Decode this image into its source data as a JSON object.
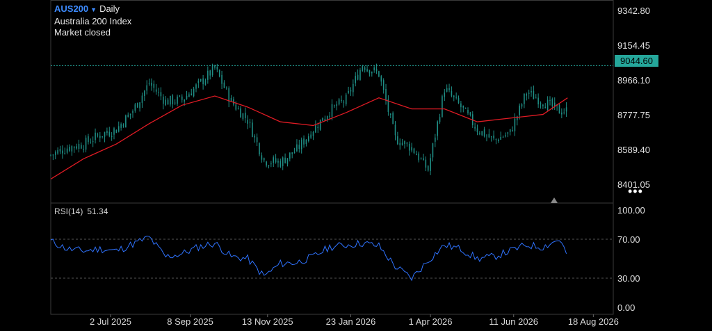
{
  "header": {
    "symbol": "AUS200",
    "interval": "Daily",
    "index_name": "Australia 200 Index",
    "market_status": "Market closed"
  },
  "current_price": "9044.60",
  "colors": {
    "background": "#000000",
    "candle": "#1f8f86",
    "moving_average": "#e01b24",
    "rsi_line": "#2f73ff",
    "price_line": "#25a79b",
    "grid_border": "#3a3a3a"
  },
  "icons": {
    "symbol_caret": "▼",
    "more": "•••"
  },
  "indicator": {
    "name": "RSI(14)",
    "value": "51.34"
  },
  "chart_data": [
    {
      "type": "candlestick",
      "series": [
        {
          "name": "AUS200",
          "kind": "ohlc",
          "x": [
            "2025-05-12",
            "2025-05-26",
            "2025-06-09",
            "2025-06-23",
            "2025-07-07",
            "2025-07-21",
            "2025-08-04",
            "2025-08-18",
            "2025-09-01",
            "2025-09-15",
            "2025-09-29",
            "2025-10-13",
            "2025-10-27",
            "2025-11-10",
            "2025-11-24",
            "2025-12-08",
            "2025-12-22",
            "2026-01-05",
            "2026-01-19",
            "2026-02-02",
            "2026-02-16",
            "2026-03-02",
            "2026-03-16",
            "2026-03-30",
            "2026-04-13",
            "2026-04-27",
            "2026-05-11",
            "2026-05-25",
            "2026-06-08",
            "2026-06-22",
            "2026-07-06",
            "2026-07-20"
          ],
          "close": [
            8560,
            8600,
            8620,
            8670,
            8700,
            8800,
            8950,
            8850,
            8860,
            8940,
            9030,
            8850,
            8750,
            8530,
            8520,
            8590,
            8700,
            8800,
            8860,
            9050,
            9000,
            8650,
            8600,
            8480,
            8920,
            8820,
            8700,
            8640,
            8680,
            8900,
            8850,
            8800
          ]
        },
        {
          "name": "MA",
          "kind": "line",
          "x": [
            "2025-05-12",
            "2025-06-09",
            "2025-07-07",
            "2025-08-04",
            "2025-09-01",
            "2025-09-29",
            "2025-10-27",
            "2025-11-24",
            "2025-12-22",
            "2026-01-19",
            "2026-02-16",
            "2026-03-16",
            "2026-04-13",
            "2026-05-11",
            "2026-06-08",
            "2026-07-06",
            "2026-07-27"
          ],
          "y": [
            8430,
            8540,
            8620,
            8730,
            8830,
            8880,
            8820,
            8740,
            8720,
            8790,
            8870,
            8810,
            8810,
            8740,
            8760,
            8780,
            8870
          ]
        }
      ],
      "y_ticks": [
        "9342.80",
        "9154.45",
        "8966.10",
        "8777.75",
        "8589.40",
        "8401.05"
      ],
      "ylim": [
        8300,
        9400
      ],
      "current_price": 9044.6
    },
    {
      "type": "line",
      "series": [
        {
          "name": "RSI(14)",
          "x": [
            "2025-05-12",
            "2025-05-26",
            "2025-06-09",
            "2025-06-23",
            "2025-07-07",
            "2025-07-21",
            "2025-08-04",
            "2025-08-18",
            "2025-09-01",
            "2025-09-15",
            "2025-09-29",
            "2025-10-13",
            "2025-10-27",
            "2025-11-10",
            "2025-11-24",
            "2025-12-08",
            "2025-12-22",
            "2026-01-05",
            "2026-01-19",
            "2026-02-02",
            "2026-02-16",
            "2026-03-02",
            "2026-03-16",
            "2026-03-30",
            "2026-04-13",
            "2026-04-27",
            "2026-05-11",
            "2026-05-25",
            "2026-06-08",
            "2026-06-22",
            "2026-07-06",
            "2026-07-20",
            "2026-07-27"
          ],
          "y": [
            68,
            60,
            58,
            60,
            58,
            65,
            72,
            52,
            55,
            62,
            66,
            52,
            50,
            32,
            45,
            46,
            52,
            62,
            64,
            66,
            63,
            42,
            30,
            48,
            64,
            60,
            50,
            52,
            58,
            64,
            62,
            70,
            53
          ]
        }
      ],
      "y_ticks": [
        "100.00",
        "70.00",
        "30.00",
        "0.00"
      ],
      "ylim": [
        0,
        100
      ],
      "reference_lines": [
        70,
        30
      ]
    }
  ],
  "x_axis": {
    "ticks": [
      {
        "label": "2 Jul 2025",
        "date": "2025-07-02"
      },
      {
        "label": "8 Sep 2025",
        "date": "2025-09-08"
      },
      {
        "label": "13 Nov 2025",
        "date": "2025-11-13"
      },
      {
        "label": "23 Jan 2026",
        "date": "2026-01-23"
      },
      {
        "label": "1 Apr 2026",
        "date": "2026-04-01"
      },
      {
        "label": "11 Jun 2026",
        "date": "2026-06-11"
      },
      {
        "label": "18 Aug 2026",
        "date": "2026-08-18"
      }
    ],
    "range": [
      "2025-05-12",
      "2026-09-04"
    ]
  }
}
